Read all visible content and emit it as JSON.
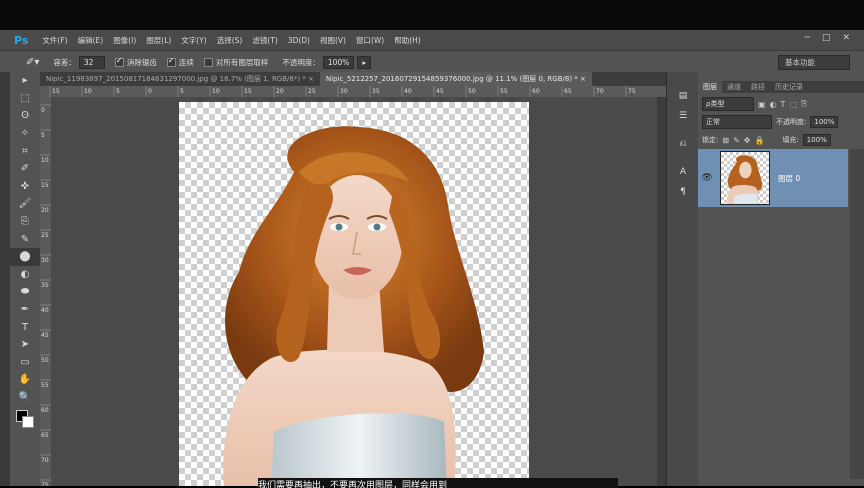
{
  "app": {
    "logo": "Ps"
  },
  "menu": [
    "文件(F)",
    "编辑(E)",
    "图像(I)",
    "图层(L)",
    "文字(Y)",
    "选择(S)",
    "滤镜(T)",
    "3D(D)",
    "视图(V)",
    "窗口(W)",
    "帮助(H)"
  ],
  "window_controls": {
    "minimize": "─",
    "maximize": "□",
    "close": "✕"
  },
  "options": {
    "tolerance_label": "容差：",
    "tolerance_value": "32",
    "antialias_label": "消除锯齿",
    "contiguous_label": "连续",
    "sample_all_label": "对所有图层取样",
    "opacity_label": "不透明度：",
    "opacity_value": "100%",
    "workspace": "基本功能"
  },
  "tabs": [
    {
      "label": "Nipic_11983897_20150817184631297000.jpg @ 16.7% (图层 1, RGB/8*) *",
      "close": "×",
      "active": false
    },
    {
      "label": "Nipic_5212257_20160729154859376000.jpg @ 11.1% (图层 0, RGB/8) *",
      "close": "×",
      "active": true
    }
  ],
  "rulers": {
    "h": [
      "15",
      "10",
      "5",
      "0",
      "5",
      "10",
      "15",
      "20",
      "25",
      "30",
      "35",
      "40",
      "45",
      "50",
      "55",
      "60",
      "65",
      "70",
      "75"
    ],
    "v": [
      "0",
      "5",
      "10",
      "15",
      "20",
      "25",
      "30",
      "35",
      "40",
      "45",
      "50",
      "55",
      "60",
      "65",
      "70",
      "75"
    ]
  },
  "tools": [
    "▸",
    "⬚",
    "ʘ",
    "✧",
    "⌗",
    "✐",
    "✜",
    "🖌",
    "⎘",
    "✎",
    "⬤",
    "◐",
    "⬬",
    "✒",
    "T",
    "➤",
    "▭",
    "✋",
    "🔍"
  ],
  "panel": {
    "tabs": [
      "图层",
      "通道",
      "路径",
      "历史记录"
    ],
    "filter_label": "ρ类型",
    "blend_mode": "正常",
    "opacity_label": "不透明度:",
    "opacity_value": "100%",
    "lock_label": "锁定:",
    "fill_label": "填充:",
    "fill_value": "100%",
    "layers": [
      {
        "name": "图层 0",
        "visible": true
      }
    ]
  },
  "subtitle": "我们需要再抽出，不要再次用图层，同样会用到"
}
